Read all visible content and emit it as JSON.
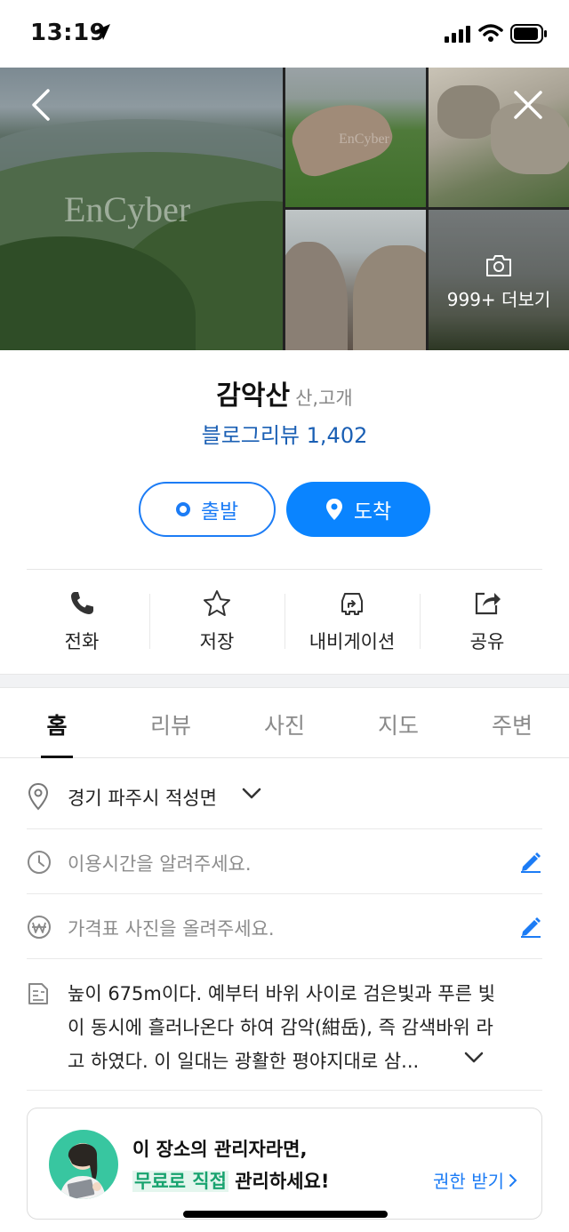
{
  "status_bar": {
    "time": "13:19"
  },
  "gallery": {
    "watermark": "EnCyber",
    "watermark_small": "EnCyber",
    "more_label": "999+ 더보기"
  },
  "place": {
    "name": "감악산",
    "category": "산,고개",
    "blog_review_label": "블로그리뷰",
    "blog_review_count": "1,402"
  },
  "route": {
    "depart_label": "출발",
    "arrive_label": "도착"
  },
  "actions": [
    {
      "label": "전화",
      "icon": "phone-icon"
    },
    {
      "label": "저장",
      "icon": "star-icon"
    },
    {
      "label": "내비게이션",
      "icon": "car-navigation-icon"
    },
    {
      "label": "공유",
      "icon": "share-icon"
    }
  ],
  "tabs": [
    {
      "label": "홈",
      "active": true
    },
    {
      "label": "리뷰",
      "active": false
    },
    {
      "label": "사진",
      "active": false
    },
    {
      "label": "지도",
      "active": false
    },
    {
      "label": "주변",
      "active": false
    }
  ],
  "info": {
    "address": "경기 파주시 적성면",
    "hours_placeholder": "이용시간을 알려주세요.",
    "price_placeholder": "가격표 사진을 올려주세요.",
    "description_lines": [
      "높이 675m이다. 예부터 바위 사이로 검은빛과 푸른 빛",
      "이 동시에 흘러나온다 하여 감악(紺岳), 즉 감색바위 라",
      "고 하였다. 이 일대는 광활한 평야지대로 삼..."
    ]
  },
  "promo": {
    "line1": "이 장소의 관리자라면,",
    "line2_highlight": "무료로 직접",
    "line2_rest": " 관리하세요!",
    "claim_label": "권한 받기"
  },
  "colors": {
    "accent": "#0a84ff",
    "link": "#1a5fb4",
    "promo_green": "#18a36f"
  }
}
